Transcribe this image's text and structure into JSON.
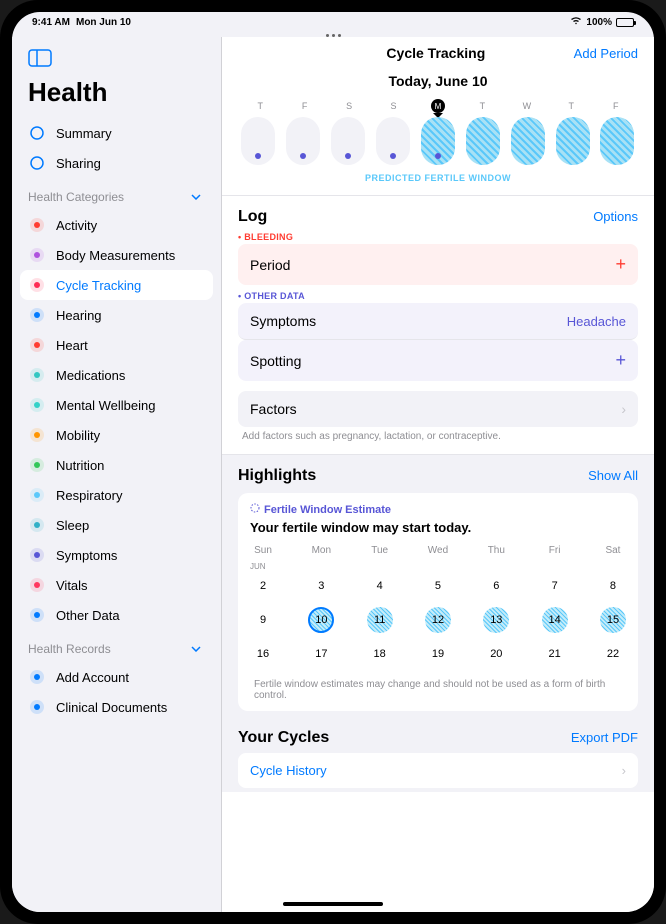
{
  "status": {
    "time": "9:41 AM",
    "date": "Mon Jun 10",
    "battery": "100%"
  },
  "sidebar": {
    "title": "Health",
    "top": [
      {
        "label": "Summary",
        "icon": "heart-outline"
      },
      {
        "label": "Sharing",
        "icon": "people"
      }
    ],
    "categories_label": "Health Categories",
    "categories": [
      {
        "label": "Activity",
        "color": "#ff3b30"
      },
      {
        "label": "Body Measurements",
        "color": "#af52de"
      },
      {
        "label": "Cycle Tracking",
        "color": "#ff2d55",
        "selected": true
      },
      {
        "label": "Hearing",
        "color": "#007aff"
      },
      {
        "label": "Heart",
        "color": "#ff3b30"
      },
      {
        "label": "Medications",
        "color": "#34c7c2"
      },
      {
        "label": "Mental Wellbeing",
        "color": "#32d2c8"
      },
      {
        "label": "Mobility",
        "color": "#ff9500"
      },
      {
        "label": "Nutrition",
        "color": "#34c759"
      },
      {
        "label": "Respiratory",
        "color": "#5ac8fa"
      },
      {
        "label": "Sleep",
        "color": "#30b0c7"
      },
      {
        "label": "Symptoms",
        "color": "#5856d6"
      },
      {
        "label": "Vitals",
        "color": "#ff375f"
      },
      {
        "label": "Other Data",
        "color": "#007aff"
      }
    ],
    "records_label": "Health Records",
    "records": [
      {
        "label": "Add Account",
        "color": "#007aff"
      },
      {
        "label": "Clinical Documents",
        "color": "#007aff"
      }
    ]
  },
  "main": {
    "title": "Cycle Tracking",
    "add_period": "Add Period",
    "today_label": "Today, June 10",
    "week_days": [
      "T",
      "F",
      "S",
      "S",
      "M",
      "T",
      "W",
      "T",
      "F"
    ],
    "fertile_label": "PREDICTED FERTILE WINDOW",
    "log": {
      "title": "Log",
      "options": "Options",
      "bleeding_label": "• BLEEDING",
      "period_label": "Period",
      "other_label": "• OTHER DATA",
      "symptoms_label": "Symptoms",
      "symptoms_value": "Headache",
      "spotting_label": "Spotting",
      "factors_label": "Factors",
      "factors_hint": "Add factors such as pregnancy, lactation, or contraceptive."
    },
    "highlights": {
      "title": "Highlights",
      "show_all": "Show All",
      "card_title": "Fertile Window Estimate",
      "card_sub": "Your fertile window may start today.",
      "cal_days": [
        "Sun",
        "Mon",
        "Tue",
        "Wed",
        "Thu",
        "Fri",
        "Sat"
      ],
      "month": "JUN",
      "weeks": [
        [
          2,
          3,
          4,
          5,
          6,
          7,
          8
        ],
        [
          9,
          10,
          11,
          12,
          13,
          14,
          15
        ],
        [
          16,
          17,
          18,
          19,
          20,
          21,
          22
        ]
      ],
      "disclaimer": "Fertile window estimates may change and should not be used as a form of birth control."
    },
    "cycles": {
      "title": "Your Cycles",
      "export": "Export PDF",
      "history": "Cycle History"
    }
  }
}
